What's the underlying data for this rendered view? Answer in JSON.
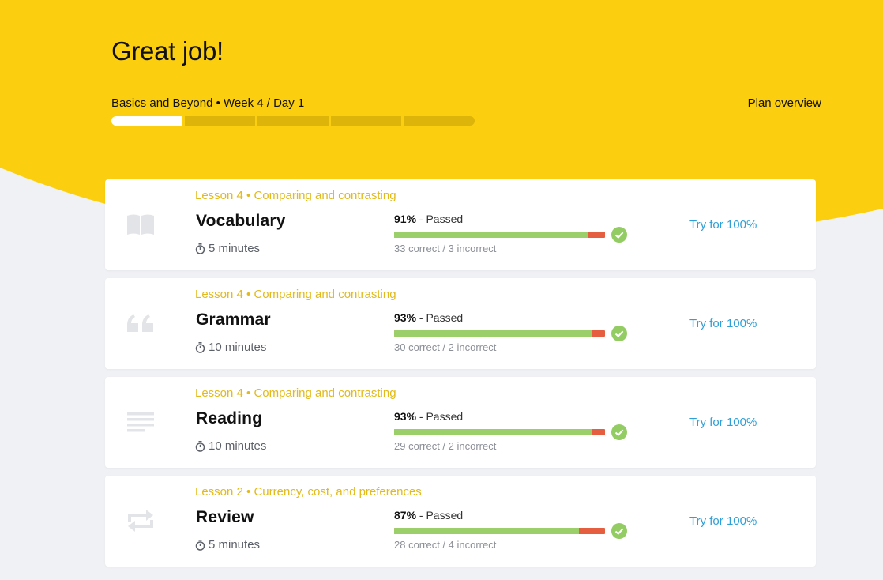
{
  "header": {
    "title": "Great job!",
    "plan_line": "Basics and Beyond • Week 4 / Day 1",
    "plan_overview_label": "Plan overview",
    "week_progress": {
      "segments": 5,
      "completed": 1
    }
  },
  "lessons": [
    {
      "icon": "book-icon",
      "lesson_label": "Lesson 4 • Comparing and contrasting",
      "title": "Vocabulary",
      "duration": "5 minutes",
      "score_pct": "91%",
      "status": "- Passed",
      "counts": "33 correct / 3 incorrect",
      "correct": 33,
      "incorrect": 3,
      "action": "Try for 100%"
    },
    {
      "icon": "quote-icon",
      "lesson_label": "Lesson 4 • Comparing and contrasting",
      "title": "Grammar",
      "duration": "10 minutes",
      "score_pct": "93%",
      "status": "- Passed",
      "counts": "30 correct / 2 incorrect",
      "correct": 30,
      "incorrect": 2,
      "action": "Try for 100%"
    },
    {
      "icon": "text-lines-icon",
      "lesson_label": "Lesson 4 • Comparing and contrasting",
      "title": "Reading",
      "duration": "10 minutes",
      "score_pct": "93%",
      "status": "- Passed",
      "counts": "29 correct / 2 incorrect",
      "correct": 29,
      "incorrect": 2,
      "action": "Try for 100%"
    },
    {
      "icon": "repeat-icon",
      "lesson_label": "Lesson 2 • Currency, cost, and preferences",
      "title": "Review",
      "duration": "5 minutes",
      "score_pct": "87%",
      "status": "- Passed",
      "counts": "28 correct / 4 incorrect",
      "correct": 28,
      "incorrect": 4,
      "action": "Try for 100%"
    }
  ],
  "colors": {
    "brand_yellow": "#fbcf0f",
    "lesson_label": "#e2ba1b",
    "correct_green": "#9bcf6a",
    "incorrect_red": "#e55e3f",
    "link_blue": "#2f9fd6",
    "page_bg": "#f0f1f4"
  }
}
